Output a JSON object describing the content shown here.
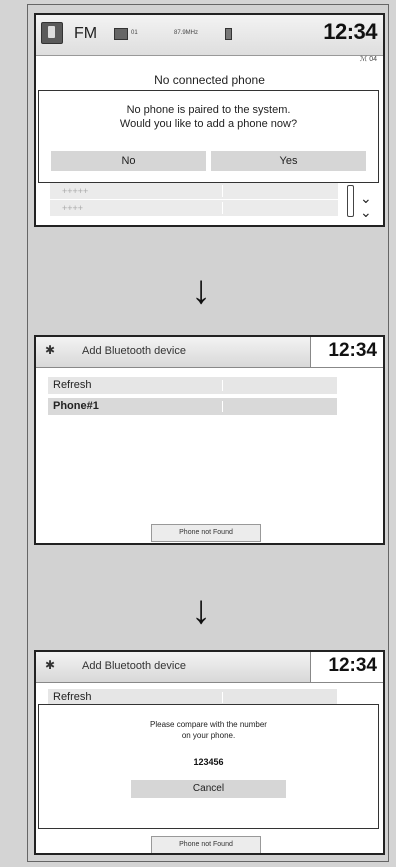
{
  "screen1": {
    "radio_band": "FM",
    "preset_label": "01",
    "frequency_label": "87.9MHz",
    "clock": "12:34",
    "signal_label": "ℳ 04",
    "no_connected": "No connected phone",
    "dialog_line1": "No phone is paired to the system.",
    "dialog_line2": "Would you like to add a phone now?",
    "no_label": "No",
    "yes_label": "Yes",
    "ghost_row_1": "+++++",
    "ghost_row_2": "++++"
  },
  "screen2": {
    "title": "Add Bluetooth device",
    "clock": "12:34",
    "list": [
      {
        "label": "Refresh"
      },
      {
        "label": "Phone#1"
      }
    ],
    "footer_button": "Phone not Found"
  },
  "screen3": {
    "title": "Add Bluetooth device",
    "clock": "12:34",
    "refresh_label": "Refresh",
    "dialog_line1": "Please compare with the number",
    "dialog_line2": "on your phone.",
    "pair_code": "123456",
    "cancel_label": "Cancel",
    "footer_button": "Phone not Found"
  },
  "icons": {
    "down_arrow": "↓",
    "gear": "✱",
    "chevron": "»"
  }
}
